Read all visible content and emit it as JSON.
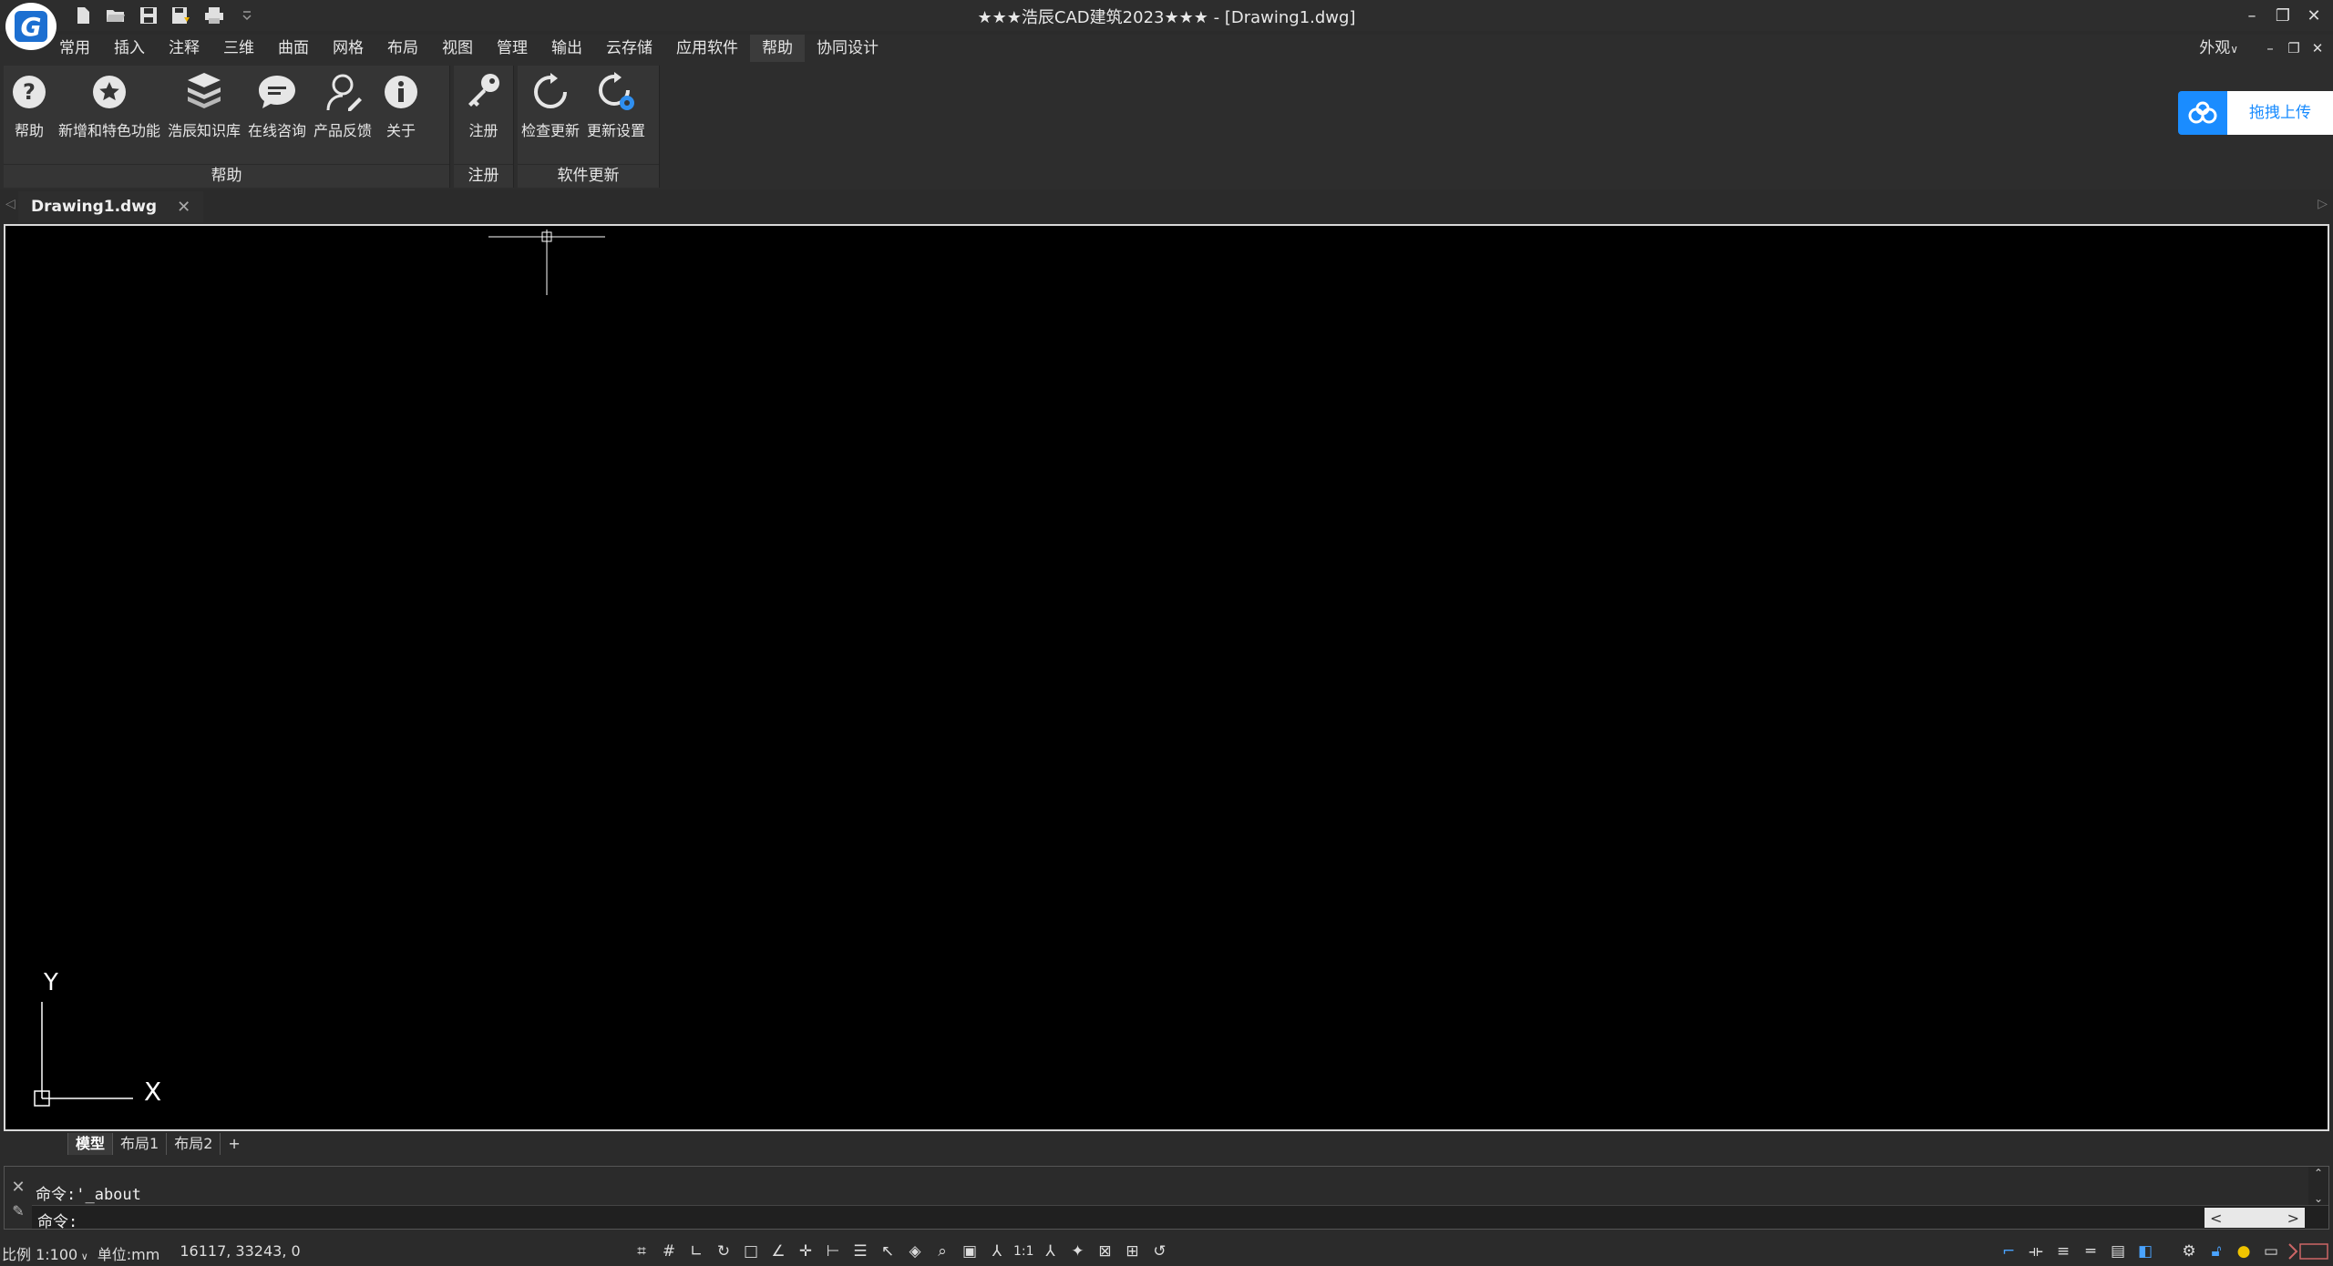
{
  "app": {
    "title": "★★★浩辰CAD建筑2023★★★ - [Drawing1.dwg]",
    "logo_icon": "gstarcad-logo",
    "accent_color": "#1c6fd1"
  },
  "quick_access": [
    {
      "name": "new-icon"
    },
    {
      "name": "open-icon"
    },
    {
      "name": "save-icon"
    },
    {
      "name": "save-as-icon"
    },
    {
      "name": "print-icon"
    },
    {
      "name": "customize-dropdown-icon"
    }
  ],
  "menu": {
    "items": [
      "常用",
      "插入",
      "注释",
      "三维",
      "曲面",
      "网格",
      "布局",
      "视图",
      "管理",
      "输出",
      "云存储",
      "应用软件",
      "帮助",
      "协同设计"
    ],
    "active": "帮助",
    "appearance_label": "外观"
  },
  "ribbon": {
    "panels": [
      {
        "title": "帮助",
        "tools": [
          {
            "label": "帮助",
            "icon": "help-icon"
          },
          {
            "label": "新增和特色功能",
            "icon": "star-icon"
          },
          {
            "label": "浩辰知识库",
            "icon": "books-icon"
          },
          {
            "label": "在线咨询",
            "icon": "chat-icon"
          },
          {
            "label": "产品反馈",
            "icon": "feedback-icon"
          },
          {
            "label": "关于",
            "icon": "info-icon"
          }
        ]
      },
      {
        "title": "注册",
        "tools": [
          {
            "label": "注册",
            "icon": "key-icon"
          }
        ]
      },
      {
        "title": "软件更新",
        "tools": [
          {
            "label": "检查更新",
            "icon": "refresh-icon"
          },
          {
            "label": "更新设置",
            "icon": "refresh-gear-icon"
          }
        ]
      }
    ],
    "upload_label": "拖拽上传",
    "upload_color": "#1a8cff"
  },
  "document": {
    "tab_name": "Drawing1.dwg"
  },
  "canvas": {
    "background": "#000000",
    "ucs_x": "X",
    "ucs_y": "Y"
  },
  "layout_tabs": {
    "items": [
      "模型",
      "布局1",
      "布局2",
      "+"
    ],
    "active": "模型"
  },
  "command": {
    "history_line": "命令:'_about",
    "prompt": "命令:"
  },
  "status": {
    "scale": "比例 1:100",
    "unit": "单位:mm",
    "coords": "16117, 33243, 0",
    "annotation_scale": "1:1"
  }
}
